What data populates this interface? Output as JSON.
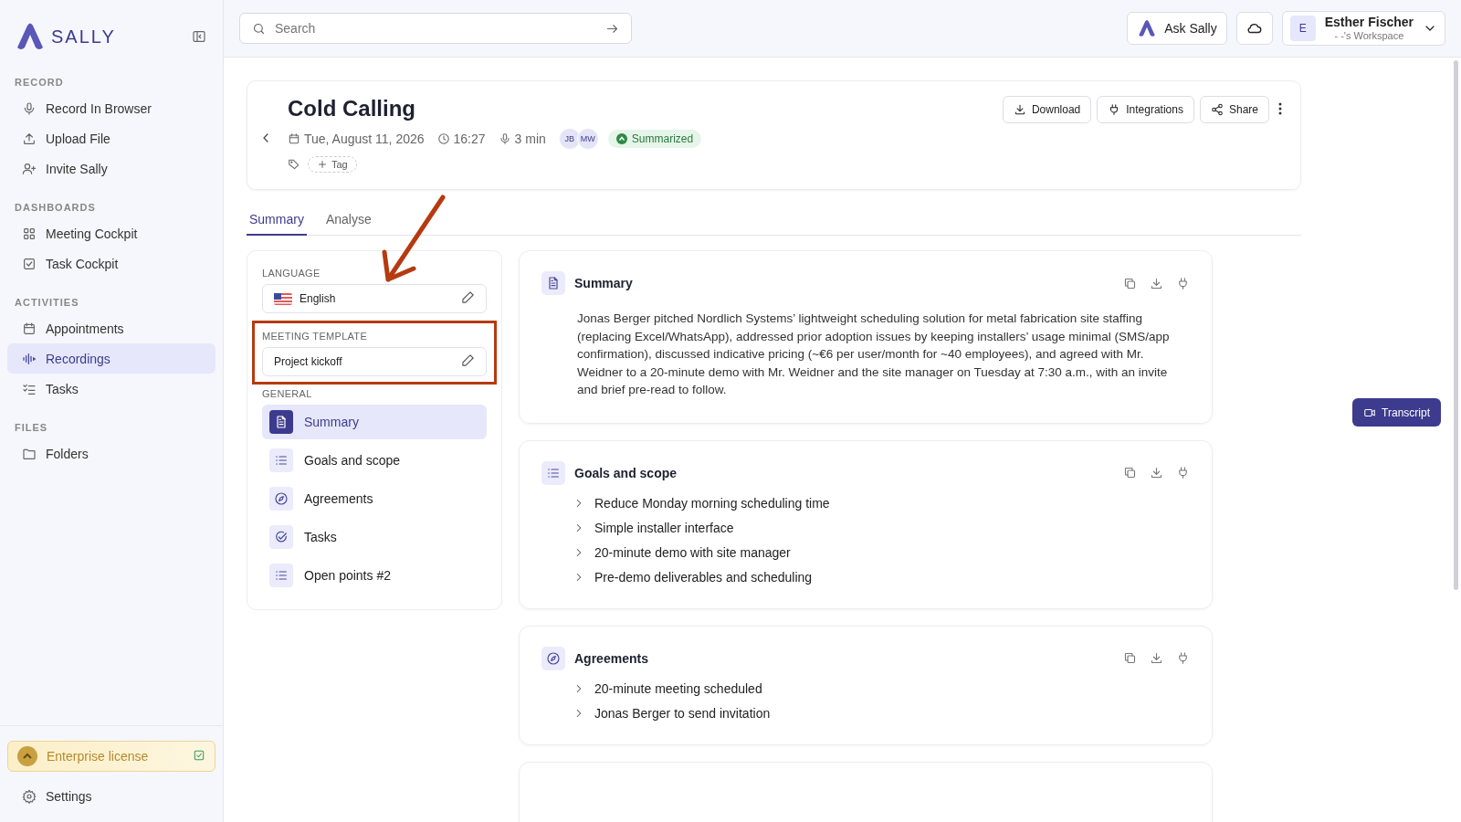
{
  "sidebar": {
    "brand": "SALLY",
    "sections": [
      {
        "title": "RECORD",
        "items": [
          {
            "label": "Record In Browser",
            "selected": false
          },
          {
            "label": "Upload File",
            "selected": false
          },
          {
            "label": "Invite Sally",
            "selected": false
          }
        ]
      },
      {
        "title": "DASHBOARDS",
        "items": [
          {
            "label": "Meeting Cockpit",
            "selected": false
          },
          {
            "label": "Task Cockpit",
            "selected": false
          }
        ]
      },
      {
        "title": "ACTIVITIES",
        "items": [
          {
            "label": "Appointments",
            "selected": false
          },
          {
            "label": "Recordings",
            "selected": true
          },
          {
            "label": "Tasks",
            "selected": false
          }
        ]
      },
      {
        "title": "FILES",
        "items": [
          {
            "label": "Folders",
            "selected": false
          }
        ]
      }
    ],
    "license": "Enterprise license",
    "settings": "Settings"
  },
  "topbar": {
    "search": {
      "placeholder": "Search"
    },
    "ask": "Ask Sally",
    "user": {
      "initial": "E",
      "name": "Esther Fischer",
      "workspace": "- -'s Workspace"
    }
  },
  "recording": {
    "title": "Cold Calling",
    "date": "Tue, August 11, 2026",
    "time": "16:27",
    "duration": "3 min",
    "participants": [
      "JB",
      "MW"
    ],
    "status": "Summarized",
    "tag_button": "Tag",
    "actions": [
      "Download",
      "Integrations",
      "Share"
    ]
  },
  "tabs": [
    {
      "label": "Summary",
      "selected": true
    },
    {
      "label": "Analyse",
      "selected": false
    }
  ],
  "settings_panel": {
    "language": {
      "label": "LANGUAGE",
      "value": "English"
    },
    "template": {
      "label": "MEETING TEMPLATE",
      "value": "Project kickoff",
      "highlighted": true
    },
    "general_label": "GENERAL",
    "items": [
      {
        "label": "Summary",
        "selected": true
      },
      {
        "label": "Goals and scope",
        "selected": false
      },
      {
        "label": "Agreements",
        "selected": false
      },
      {
        "label": "Tasks",
        "selected": false
      },
      {
        "label": "Open points #2",
        "selected": false
      }
    ]
  },
  "sections": [
    {
      "title": "Summary",
      "kind": "paragraph",
      "text": "Jonas Berger pitched Nordlich Systems’ lightweight scheduling solution for metal fabrication site staffing (replacing Excel/WhatsApp), addressed prior adoption issues by keeping installers’ usage minimal (SMS/app confirmation), discussed indicative pricing (~€6 per user/month for ~40 employees), and agreed with Mr. Weidner to a 20-minute demo with Mr. Weidner and the site manager on Tuesday at 7:30 a.m., with an invite and brief pre-read to follow."
    },
    {
      "title": "Goals and scope",
      "kind": "bullets",
      "items": [
        "Reduce Monday morning scheduling time",
        "Simple installer interface",
        "20-minute demo with site manager",
        "Pre-demo deliverables and scheduling"
      ]
    },
    {
      "title": "Agreements",
      "kind": "bullets",
      "items": [
        "20-minute meeting scheduled",
        "Jonas Berger to send invitation"
      ]
    }
  ],
  "transcript_button": "Transcript"
}
